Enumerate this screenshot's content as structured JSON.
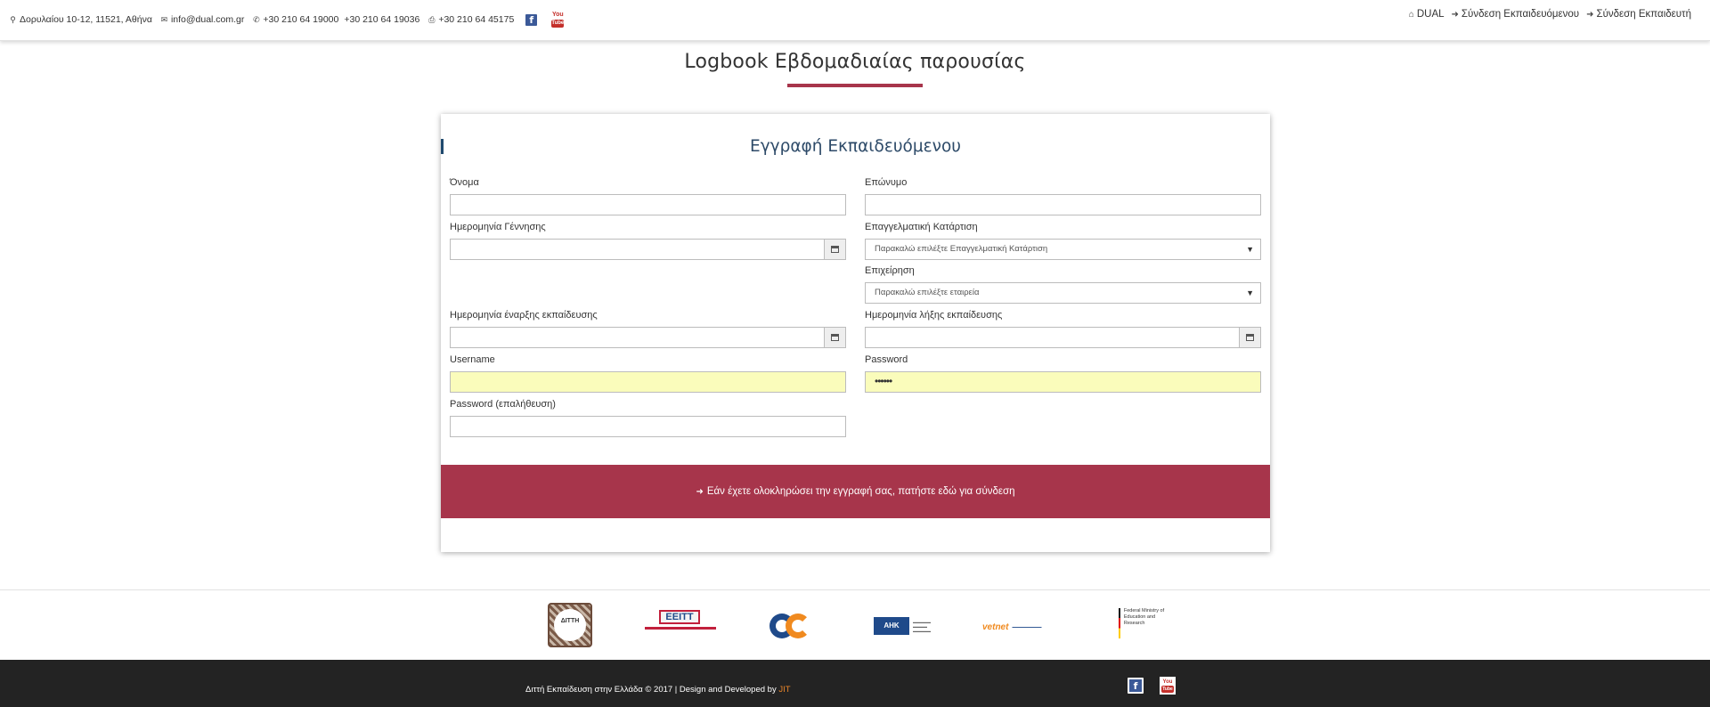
{
  "contact": {
    "address": "Δορυλαίου 10-12, 11521, Αθήνα",
    "email": "info@dual.com.gr",
    "phone1": "+30 210 64 19000",
    "phone2": "+30 210 64 19036",
    "fax": "+30 210 64 45175"
  },
  "topnav": {
    "home": "DUAL",
    "trainee_login": "Σύνδεση Εκπαιδευόμενου",
    "trainer_login": "Σύνδεση Εκπαιδευτή"
  },
  "page": {
    "title": "Logbook Εβδομαδιαίας παρουσίας"
  },
  "form": {
    "title": "Εγγραφή Εκπαιδευόμενου",
    "first_name": {
      "label": "Όνομα",
      "value": ""
    },
    "last_name": {
      "label": "Επώνυμο",
      "value": ""
    },
    "birth_date": {
      "label": "Ημερομηνία Γέννησης",
      "value": ""
    },
    "specialty": {
      "label": "Επαγγελματική Κατάρτιση",
      "selected": "Παρακαλώ επιλέξτε Επαγγελματική Κατάρτιση"
    },
    "company": {
      "label": "Επιχείρηση",
      "selected": "Παρακαλώ επιλέξτε εταιρεία"
    },
    "start_date": {
      "label": "Ημερομηνία έναρξης εκπαίδευσης",
      "value": ""
    },
    "end_date": {
      "label": "Ημερομηνία λήξης εκπαίδευσης",
      "value": ""
    },
    "username": {
      "label": "Username",
      "value": ""
    },
    "password": {
      "label": "Password",
      "value": "••••••"
    },
    "password_confirm": {
      "label": "Password (επαλήθευση)",
      "value": ""
    },
    "login_prompt": "Εάν έχετε ολοκληρώσει την εγγραφή σας, πατήστε εδώ για σύνδεση"
  },
  "partners": {
    "ditth": "ΔΙΤΤΗ",
    "eeitt": "ΕΕΙΤΤ",
    "ahk": "AHK",
    "vetnet": "vetnet",
    "bmbf": "Federal Ministry of Education and Research"
  },
  "footer": {
    "text": "Διττή Εκπαίδευση στην Ελλάδα © 2017 | Design and Developed by ",
    "dev": "JIT"
  },
  "colors": {
    "accent": "#a7354b",
    "heading": "#2d4a68",
    "highlight_input": "#fafcbb",
    "footer_bg": "#232323"
  },
  "icons": [
    "map-marker-icon",
    "envelope-icon",
    "phone-icon",
    "fax-icon",
    "facebook-icon",
    "youtube-icon",
    "home-icon",
    "sign-in-icon",
    "calendar-icon",
    "caret-down-icon"
  ]
}
